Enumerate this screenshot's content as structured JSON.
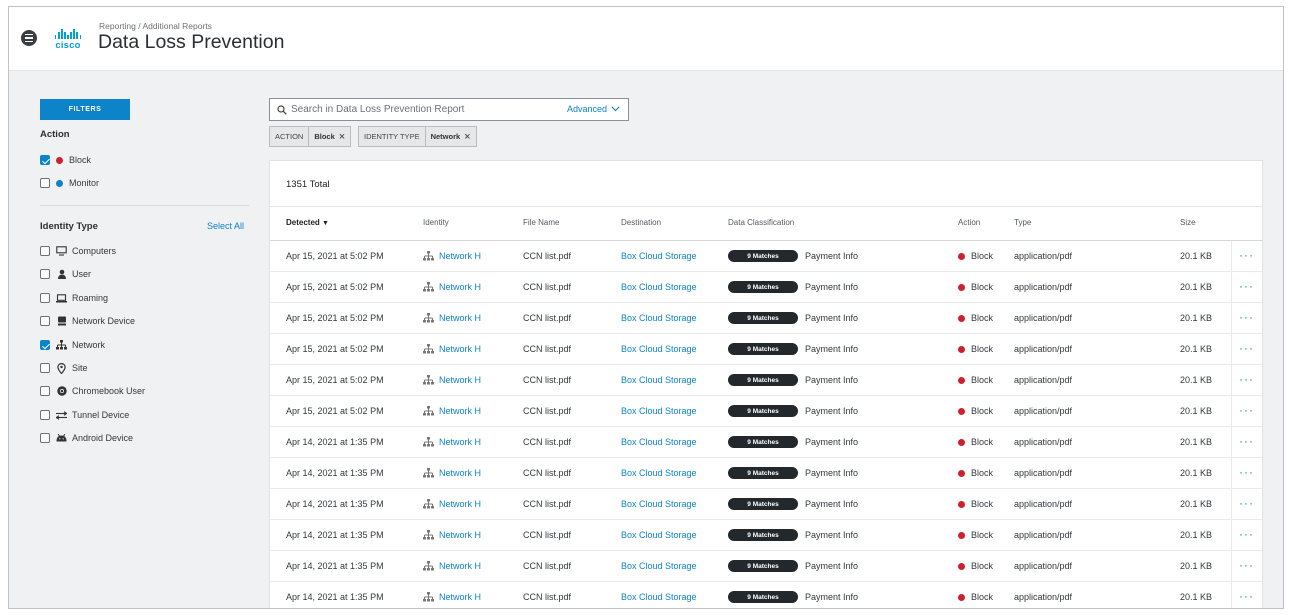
{
  "header": {
    "breadcrumb": "Reporting / Additional Reports",
    "title": "Data Loss Prevention",
    "logo_text": "cisco"
  },
  "sidebar": {
    "filters_button": "FILTERS",
    "action_label": "Action",
    "actions": [
      {
        "label": "Block",
        "checked": true,
        "color": "#cf2030"
      },
      {
        "label": "Monitor",
        "checked": false,
        "color": "#0d83c9"
      }
    ],
    "identity_type_label": "Identity Type",
    "select_all": "Select All",
    "identity_types": [
      {
        "label": "Computers",
        "checked": false,
        "icon": "monitor-icon"
      },
      {
        "label": "User",
        "checked": false,
        "icon": "user-icon"
      },
      {
        "label": "Roaming",
        "checked": false,
        "icon": "laptop-icon"
      },
      {
        "label": "Network Device",
        "checked": false,
        "icon": "network-device-icon"
      },
      {
        "label": "Network",
        "checked": true,
        "icon": "network-icon"
      },
      {
        "label": "Site",
        "checked": false,
        "icon": "location-pin-icon"
      },
      {
        "label": "Chromebook User",
        "checked": false,
        "icon": "chrome-icon"
      },
      {
        "label": "Tunnel Device",
        "checked": false,
        "icon": "tunnel-arrows-icon"
      },
      {
        "label": "Android Device",
        "checked": false,
        "icon": "android-icon"
      }
    ]
  },
  "search": {
    "placeholder": "Search in Data Loss Prevention Report",
    "advanced_label": "Advanced"
  },
  "chips": [
    {
      "key": "ACTION",
      "value": "Block"
    },
    {
      "key": "IDENTITY TYPE",
      "value": "Network"
    }
  ],
  "table": {
    "total": "1351 Total",
    "columns": [
      "Detected",
      "Identity",
      "File Name",
      "Destination",
      "Data Classification",
      "Action",
      "Type",
      "Size"
    ],
    "rows": [
      {
        "detected": "Apr 15, 2021 at 5:02 PM",
        "identity": "Network H",
        "file": "CCN list.pdf",
        "destination": "Box Cloud Storage",
        "matches": "9 Matches",
        "classification": "Payment Info",
        "action": "Block",
        "type": "application/pdf",
        "size": "20.1 KB"
      },
      {
        "detected": "Apr 15, 2021 at 5:02 PM",
        "identity": "Network H",
        "file": "CCN list.pdf",
        "destination": "Box Cloud Storage",
        "matches": "9 Matches",
        "classification": "Payment Info",
        "action": "Block",
        "type": "application/pdf",
        "size": "20.1 KB"
      },
      {
        "detected": "Apr 15, 2021 at 5:02 PM",
        "identity": "Network H",
        "file": "CCN list.pdf",
        "destination": "Box Cloud Storage",
        "matches": "9 Matches",
        "classification": "Payment Info",
        "action": "Block",
        "type": "application/pdf",
        "size": "20.1 KB"
      },
      {
        "detected": "Apr 15, 2021 at 5:02 PM",
        "identity": "Network H",
        "file": "CCN list.pdf",
        "destination": "Box Cloud Storage",
        "matches": "9 Matches",
        "classification": "Payment Info",
        "action": "Block",
        "type": "application/pdf",
        "size": "20.1 KB"
      },
      {
        "detected": "Apr 15, 2021 at 5:02 PM",
        "identity": "Network H",
        "file": "CCN list.pdf",
        "destination": "Box Cloud Storage",
        "matches": "9 Matches",
        "classification": "Payment Info",
        "action": "Block",
        "type": "application/pdf",
        "size": "20.1 KB"
      },
      {
        "detected": "Apr 15, 2021 at 5:02 PM",
        "identity": "Network H",
        "file": "CCN list.pdf",
        "destination": "Box Cloud Storage",
        "matches": "9 Matches",
        "classification": "Payment Info",
        "action": "Block",
        "type": "application/pdf",
        "size": "20.1 KB"
      },
      {
        "detected": "Apr 14, 2021 at 1:35 PM",
        "identity": "Network H",
        "file": "CCN list.pdf",
        "destination": "Box Cloud Storage",
        "matches": "9 Matches",
        "classification": "Payment Info",
        "action": "Block",
        "type": "application/pdf",
        "size": "20.1 KB"
      },
      {
        "detected": "Apr 14, 2021 at 1:35 PM",
        "identity": "Network H",
        "file": "CCN list.pdf",
        "destination": "Box Cloud Storage",
        "matches": "9 Matches",
        "classification": "Payment Info",
        "action": "Block",
        "type": "application/pdf",
        "size": "20.1 KB"
      },
      {
        "detected": "Apr 14, 2021 at 1:35 PM",
        "identity": "Network H",
        "file": "CCN list.pdf",
        "destination": "Box Cloud Storage",
        "matches": "9 Matches",
        "classification": "Payment Info",
        "action": "Block",
        "type": "application/pdf",
        "size": "20.1 KB"
      },
      {
        "detected": "Apr 14, 2021 at 1:35 PM",
        "identity": "Network H",
        "file": "CCN list.pdf",
        "destination": "Box Cloud Storage",
        "matches": "9 Matches",
        "classification": "Payment Info",
        "action": "Block",
        "type": "application/pdf",
        "size": "20.1 KB"
      },
      {
        "detected": "Apr 14, 2021 at 1:35 PM",
        "identity": "Network H",
        "file": "CCN list.pdf",
        "destination": "Box Cloud Storage",
        "matches": "9 Matches",
        "classification": "Payment Info",
        "action": "Block",
        "type": "application/pdf",
        "size": "20.1 KB"
      },
      {
        "detected": "Apr 14, 2021 at 1:35 PM",
        "identity": "Network H",
        "file": "CCN list.pdf",
        "destination": "Box Cloud Storage",
        "matches": "9 Matches",
        "classification": "Payment Info",
        "action": "Block",
        "type": "application/pdf",
        "size": "20.1 KB"
      }
    ]
  }
}
